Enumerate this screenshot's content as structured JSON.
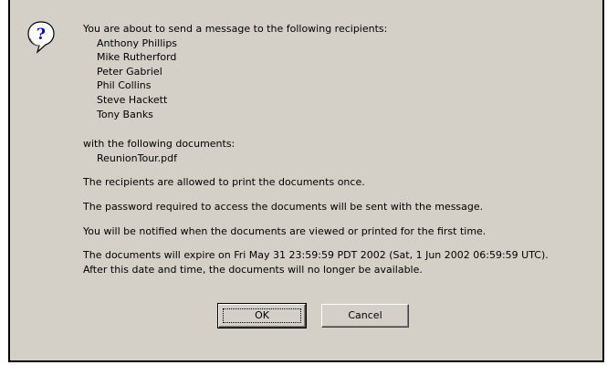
{
  "dialog": {
    "icon": "question-mark-balloon-icon",
    "intro": "You are about to send a message to the following recipients:",
    "recipients": [
      "Anthony Phillips",
      "Mike Rutherford",
      "Peter Gabriel",
      "Phil Collins",
      "Steve Hackett",
      "Tony Banks"
    ],
    "documents_intro": "with the following documents:",
    "documents": [
      "ReunionTour.pdf"
    ],
    "print_notice": "The recipients are allowed to print the documents once.",
    "password_notice": "The password required to access the documents will be sent with the message.",
    "notify_notice": "You will be notified when the documents are viewed or printed for the first time.",
    "expire_line1": "The documents will expire on Fri May 31 23:59:59 PDT 2002 (Sat, 1 Jun 2002 06:59:59 UTC).",
    "expire_line2": "After this date and time, the documents will no longer be available.",
    "ok_label": "OK",
    "cancel_label": "Cancel"
  },
  "colors": {
    "dialog_bg": "#d4d0c8",
    "icon_blue": "#0000ff"
  }
}
